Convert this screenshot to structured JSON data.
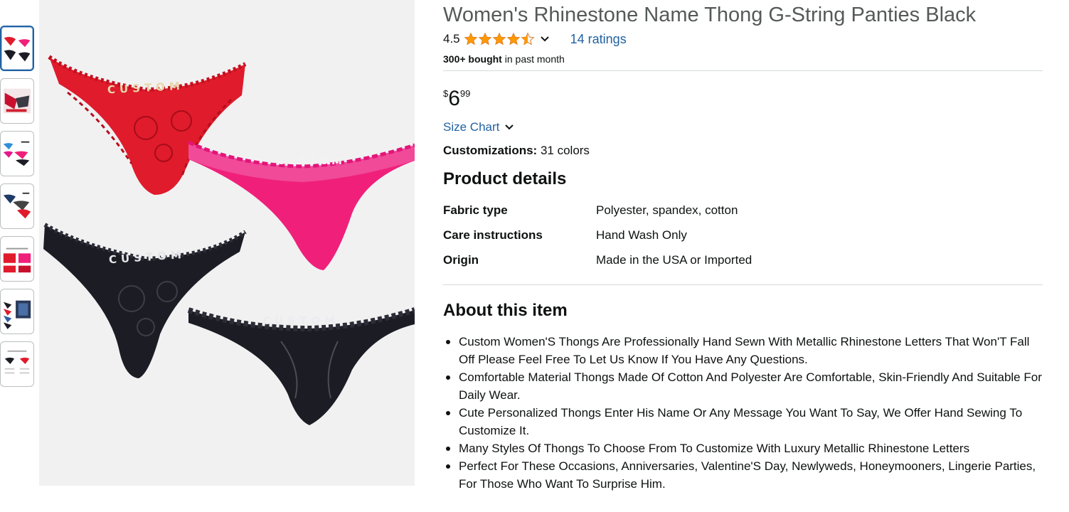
{
  "product": {
    "title": "Women's Rhinestone Name Thong G-String Panties Black",
    "rating": "4.5",
    "rating_value": 4.5,
    "ratings_count_label": "14 ratings",
    "bought_bold": "300+ bought",
    "bought_rest": " in past month",
    "price": {
      "symbol": "$",
      "whole": "6",
      "fraction": "99"
    },
    "size_chart_label": "Size Chart",
    "customizations_label": "Customizations:",
    "customizations_value": " 31 colors"
  },
  "product_details": {
    "heading": "Product details",
    "rows": [
      {
        "key": "Fabric type",
        "value": "Polyester, spandex, cotton"
      },
      {
        "key": "Care instructions",
        "value": "Hand Wash Only"
      },
      {
        "key": "Origin",
        "value": "Made in the USA or Imported"
      }
    ]
  },
  "about": {
    "heading": "About this item",
    "bullets": [
      "Custom Women'S Thongs Are Professionally Hand Sewn With Metallic Rhinestone Letters That Won'T Fall Off Please Feel Free To Let Us Know If You Have Any Questions.",
      "Comfortable Material Thongs Made Of Cotton And Polyester Are Comfortable, Skin-Friendly And Suitable For Daily Wear.",
      "Cute Personalized Thongs Enter His Name Or Any Message You Want To Say, We Offer Hand Sewing To Customize It.",
      "Many Styles Of Thongs To Choose From To Customize With Luxury Metallic Rhinestone Letters",
      "Perfect For These Occasions, Anniversaries, Valentine'S Day, Newlyweds, Honeymooners, Lingerie Parties, For Those Who Want To Surprise Him."
    ]
  },
  "main_image": {
    "labels": [
      "CUSTOM",
      "CUSTOM",
      "CUSTOM",
      "CUSTOM"
    ]
  },
  "colors": {
    "link": "#2162a1",
    "star": "#ff9900",
    "title": "#565959",
    "text": "#0f1111",
    "red": "#e01b2c",
    "pink": "#f0207a",
    "black": "#1c1d24"
  },
  "icons": {
    "share": "share-icon",
    "star": "star-icon",
    "chevron": "chevron-down-icon"
  }
}
